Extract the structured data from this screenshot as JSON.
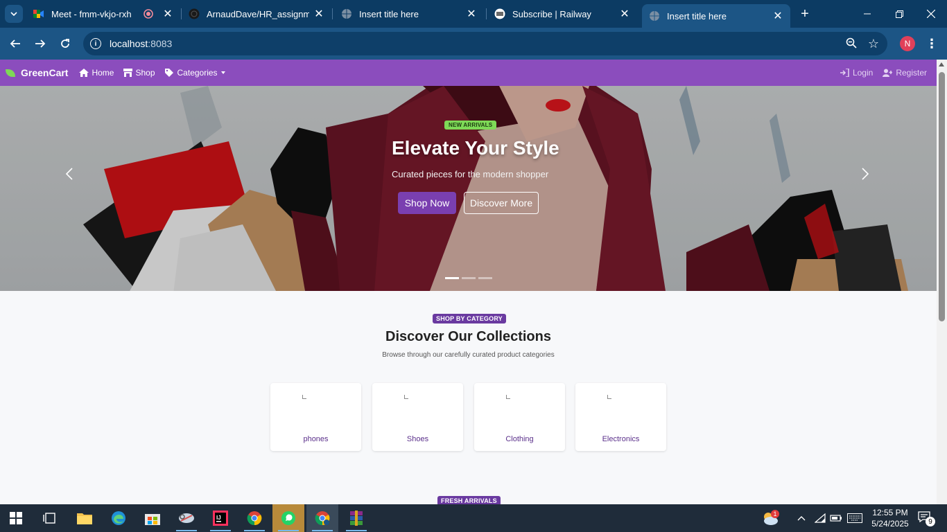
{
  "browser": {
    "tabs": [
      {
        "title": "Meet - fmm-vkjo-rxh",
        "icon": "google-meet-icon",
        "recording": true
      },
      {
        "title": "ArnaudDave/HR_assignment",
        "icon": "github-icon"
      },
      {
        "title": "Insert title here",
        "icon": "globe-icon"
      },
      {
        "title": "Subscribe | Railway",
        "icon": "railway-icon"
      },
      {
        "title": "Insert title here",
        "icon": "globe-icon",
        "active": true
      }
    ],
    "url_host": "localhost",
    "url_port": ":8083",
    "profile_initial": "N"
  },
  "site": {
    "brand": "GreenCart",
    "nav": {
      "home": "Home",
      "shop": "Shop",
      "categories": "Categories",
      "login": "Login",
      "register": "Register"
    },
    "hero": {
      "badge": "NEW ARRIVALS",
      "title": "Elevate Your Style",
      "subtitle": "Curated pieces for the modern shopper",
      "primary_cta": "Shop Now",
      "secondary_cta": "Discover More",
      "slides_total": 3,
      "active_slide": 1
    },
    "collections": {
      "pill": "SHOP BY CATEGORY",
      "title": "Discover Our Collections",
      "subtitle": "Browse through our carefully curated product categories",
      "categories": [
        "phones",
        "Shoes",
        "Clothing",
        "Electronics"
      ]
    },
    "fresh": {
      "pill": "FRESH ARRIVALS"
    }
  },
  "taskbar": {
    "time": "12:55 PM",
    "date": "5/24/2025",
    "weather_badge": "1",
    "notification_count": "9"
  },
  "colors": {
    "navbar": "#8b4dbd",
    "accent": "#7a3fb0",
    "badge_green": "#7ed957",
    "browser_frame": "#0c3b63"
  }
}
